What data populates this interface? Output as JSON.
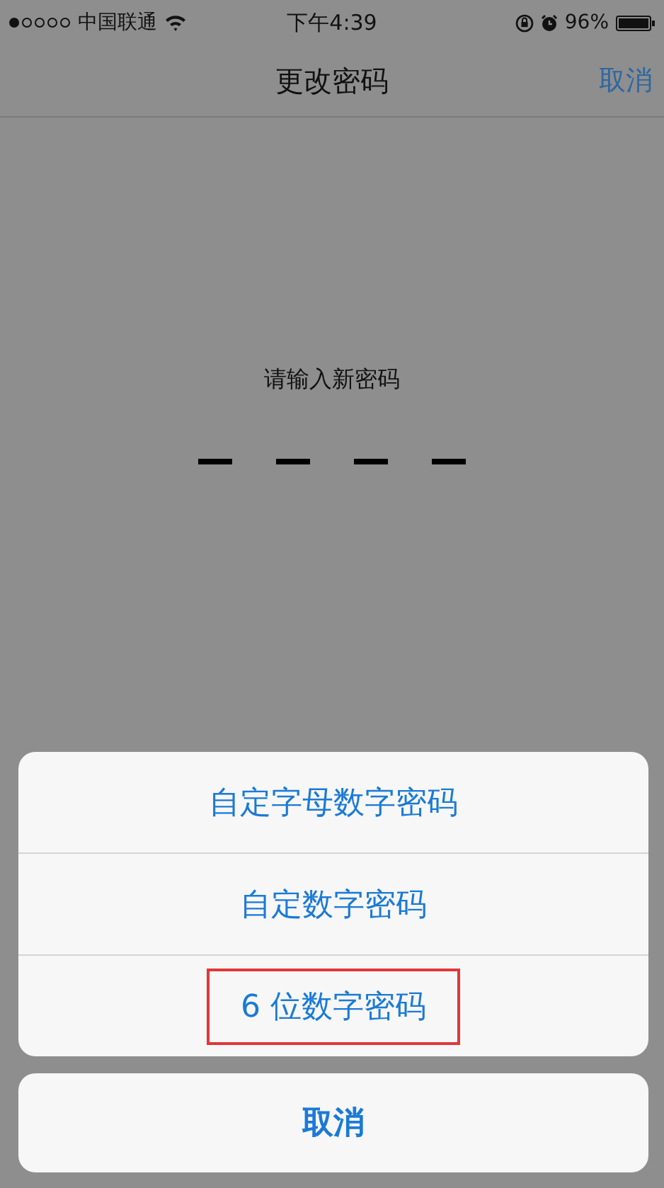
{
  "status_bar": {
    "carrier": "中国联通",
    "time": "下午4:39",
    "battery": "96%"
  },
  "nav_bar": {
    "title": "更改密码",
    "cancel": "取消"
  },
  "prompt": "请输入新密码",
  "passcode_slots": [
    {
      "filled": false
    },
    {
      "filled": false
    },
    {
      "filled": false
    },
    {
      "filled": false
    }
  ],
  "action_sheet": {
    "options": [
      {
        "label": "自定字母数字密码",
        "highlighted": false
      },
      {
        "label": "自定数字密码",
        "highlighted": false
      },
      {
        "label": "6 位数字密码",
        "highlighted": true
      }
    ],
    "cancel": "取消"
  }
}
